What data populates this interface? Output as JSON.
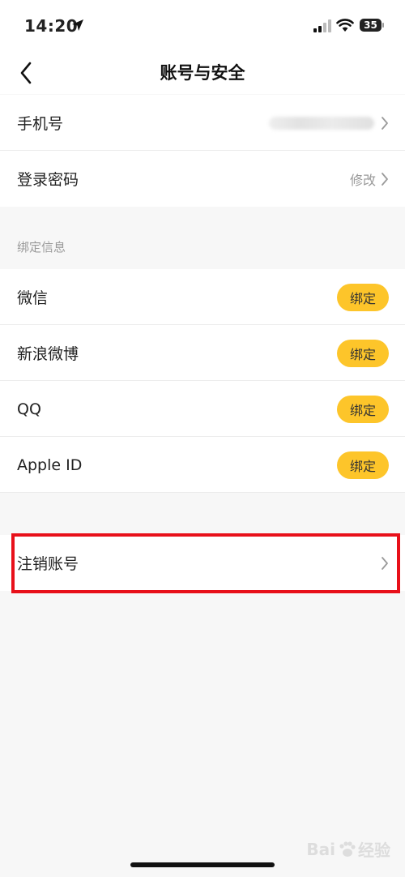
{
  "status_bar": {
    "time": "14:20",
    "battery": "35"
  },
  "nav": {
    "title": "账号与安全"
  },
  "account": {
    "phone_label": "手机号",
    "password_label": "登录密码",
    "password_action": "修改"
  },
  "binding": {
    "section_title": "绑定信息",
    "items": [
      {
        "label": "微信",
        "button": "绑定"
      },
      {
        "label": "新浪微博",
        "button": "绑定"
      },
      {
        "label": "QQ",
        "button": "绑定"
      },
      {
        "label": "Apple ID",
        "button": "绑定"
      }
    ]
  },
  "danger": {
    "cancel_account_label": "注销账号"
  },
  "watermark": {
    "text_left": "Bai",
    "text_right": "经验"
  },
  "colors": {
    "accent": "#fdc52a",
    "highlight": "#e8101a"
  }
}
